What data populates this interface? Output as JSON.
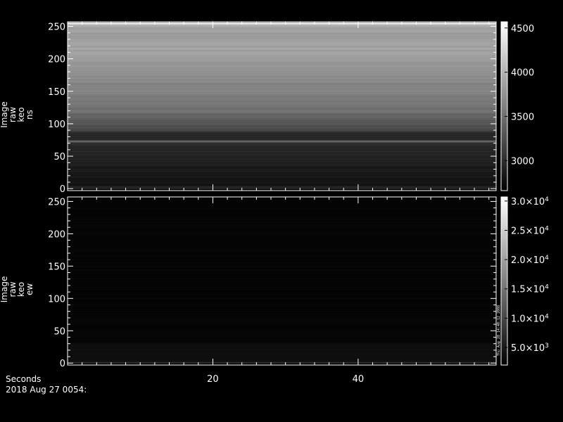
{
  "chart_data": [
    {
      "type": "heatmap",
      "ylabel_lines": [
        "Image",
        "raw",
        "keo",
        "ns"
      ],
      "x_range": [
        0,
        59
      ],
      "ylim": [
        -3,
        257
      ],
      "yticks": [
        0,
        50,
        100,
        150,
        200,
        250
      ],
      "ytick_labels": [
        "0",
        "50",
        "100",
        "150",
        "200",
        "250"
      ],
      "colorbar": {
        "range": [
          2660,
          4570
        ],
        "ticks": [
          3000,
          3500,
          4000,
          4500
        ],
        "labels": [
          "3000",
          "3500",
          "4000",
          "4500"
        ]
      },
      "row_profile": [
        {
          "y": 0,
          "value": 3000
        },
        {
          "y": 5,
          "value": 2800
        },
        {
          "y": 40,
          "value": 2900
        },
        {
          "y": 70,
          "value": 3000
        },
        {
          "y": 73,
          "value": 3500
        },
        {
          "y": 75,
          "value": 2950
        },
        {
          "y": 85,
          "value": 2950
        },
        {
          "y": 90,
          "value": 3200
        },
        {
          "y": 100,
          "value": 3300
        },
        {
          "y": 120,
          "value": 3500
        },
        {
          "y": 150,
          "value": 3650
        },
        {
          "y": 180,
          "value": 3750
        },
        {
          "y": 200,
          "value": 3850
        },
        {
          "y": 215,
          "value": 3900
        },
        {
          "y": 235,
          "value": 3820
        },
        {
          "y": 250,
          "value": 3900
        },
        {
          "y": 255,
          "value": 4400
        }
      ]
    },
    {
      "type": "heatmap",
      "ylabel_lines": [
        "Image",
        "raw",
        "keo",
        "ew"
      ],
      "x_range": [
        0,
        59
      ],
      "ylim": [
        -3,
        257
      ],
      "yticks": [
        0,
        50,
        100,
        150,
        200,
        250
      ],
      "ytick_labels": [
        "0",
        "50",
        "100",
        "150",
        "200",
        "250"
      ],
      "colorbar": {
        "range": [
          2000,
          30700
        ],
        "ticks": [
          5000,
          10000,
          15000,
          20000,
          25000,
          30000
        ],
        "labels": [
          {
            "mantissa": "5.0",
            "exp": "3"
          },
          {
            "mantissa": "1.0",
            "exp": "4"
          },
          {
            "mantissa": "1.5",
            "exp": "4"
          },
          {
            "mantissa": "2.0",
            "exp": "4"
          },
          {
            "mantissa": "2.5",
            "exp": "4"
          },
          {
            "mantissa": "3.0",
            "exp": "4"
          }
        ]
      },
      "row_profile": [
        {
          "y": 0,
          "value": 9000
        },
        {
          "y": 2,
          "value": 3800
        },
        {
          "y": 30,
          "value": 3500
        },
        {
          "y": 32,
          "value": 2600
        },
        {
          "y": 255,
          "value": 2600
        }
      ]
    }
  ],
  "shared_x": {
    "xticks": [
      20,
      40
    ],
    "xtick_labels": [
      "20",
      "40"
    ],
    "xlabel": "Seconds"
  },
  "date_text": "2018 Aug 27 0054:",
  "side_note": "Thu Aug 28 14:40:12 2008"
}
